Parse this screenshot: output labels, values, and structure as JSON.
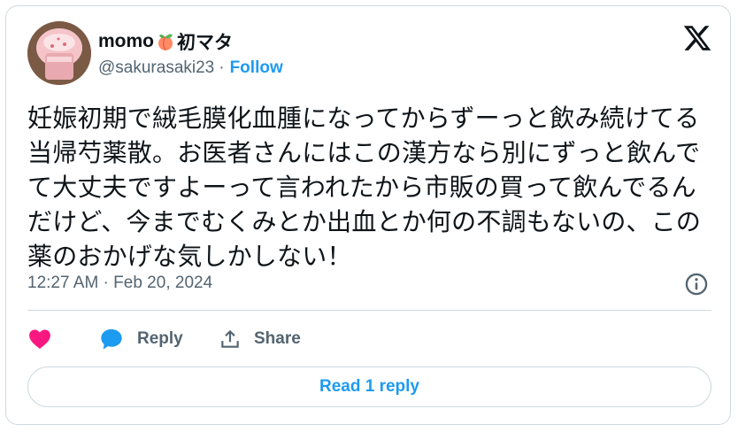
{
  "author": {
    "display_name_prefix": "momo",
    "display_name_suffix": "初マタ",
    "handle": "@sakurasaki23",
    "separator": "·",
    "follow_label": "Follow"
  },
  "tweet": {
    "text": "妊娠初期で絨毛膜化血腫になってからずーっと飲み続けてる当帰芍薬散。お医者さんにはこの漢方なら別にずっと飲んでて大丈夫ですよーって言われたから市販の買って飲んでるんだけど、今までむくみとか出血とか何の不調もないの、この薬のおかげな気しかしない！",
    "timestamp": "12:27 AM · Feb 20, 2024"
  },
  "actions": {
    "reply_label": "Reply",
    "share_label": "Share",
    "read_replies_label": "Read 1 reply"
  },
  "icons": {
    "like": "heart-icon",
    "reply": "speech-bubble-icon",
    "share": "share-upload-icon",
    "info": "info-icon",
    "brand": "x-logo-icon",
    "emoji": "peach-emoji"
  },
  "colors": {
    "accent": "#1d9bf0",
    "heart": "#f91880",
    "text": "#0f1419",
    "secondary": "#536471",
    "border": "#cfd9de"
  }
}
